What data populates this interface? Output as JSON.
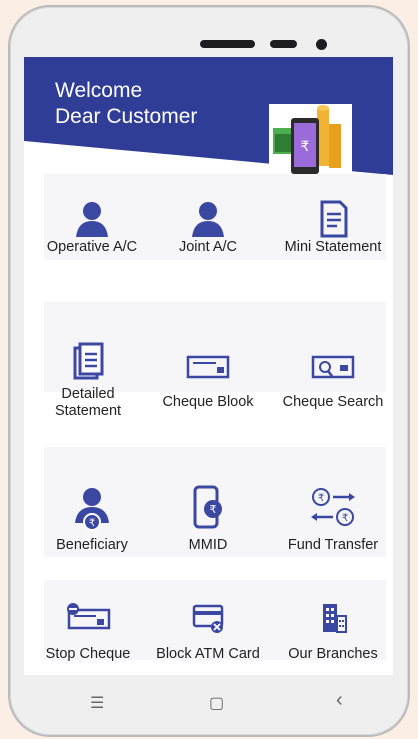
{
  "header": {
    "line1": "Welcome",
    "line2": "Dear Customer"
  },
  "colors": {
    "header": "#2f3d97",
    "icon": "#3a48a2",
    "accent": "#e53935"
  },
  "grid": [
    {
      "label": "Operative A/C",
      "icon": "user-icon"
    },
    {
      "label": "Joint A/C",
      "icon": "user-icon"
    },
    {
      "label": "Mini Statement",
      "icon": "document-icon"
    },
    {
      "label": "Detailed Statement",
      "line1": "Detailed",
      "line2": "Statement",
      "icon": "documents-icon"
    },
    {
      "label": "Cheque Blook",
      "icon": "cheque-icon"
    },
    {
      "label": "Cheque Search",
      "icon": "cheque-search-icon"
    },
    {
      "label": "Beneficiary",
      "icon": "beneficiary-icon"
    },
    {
      "label": "MMID",
      "icon": "mobile-rupee-icon"
    },
    {
      "label": "Fund Transfer",
      "icon": "fund-transfer-icon"
    },
    {
      "label": "Stop Cheque",
      "icon": "stop-cheque-icon"
    },
    {
      "label": "Block ATM Card",
      "icon": "block-card-icon"
    },
    {
      "label": "Our Branches",
      "icon": "building-icon"
    }
  ],
  "navbar": {
    "menu": "☰",
    "home": "▢",
    "back": "‹"
  }
}
